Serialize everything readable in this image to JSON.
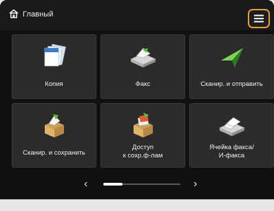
{
  "header": {
    "title": "Главный",
    "home_icon": "home-icon",
    "menu_icon": "menu-icon",
    "accent_color": "#e8a032"
  },
  "tiles": [
    {
      "label": "Копия",
      "icon": "copy-icon"
    },
    {
      "label": "Факс",
      "icon": "fax-icon"
    },
    {
      "label": "Сканир. и отправить",
      "icon": "scan-send-icon"
    },
    {
      "label": "Сканир. и сохранить",
      "icon": "scan-save-icon"
    },
    {
      "label_line1": "Доступ",
      "label_line2": "к сохр.ф-лам",
      "icon": "access-files-icon"
    },
    {
      "label_line1": "Ячейка факса/",
      "label_line2": "И-факса",
      "icon": "fax-inbox-icon"
    }
  ],
  "pager": {
    "prev_icon": "chevron-left-icon",
    "next_icon": "chevron-right-icon",
    "prev_glyph": "‹",
    "next_glyph": "›",
    "position_fraction": 0.0
  }
}
